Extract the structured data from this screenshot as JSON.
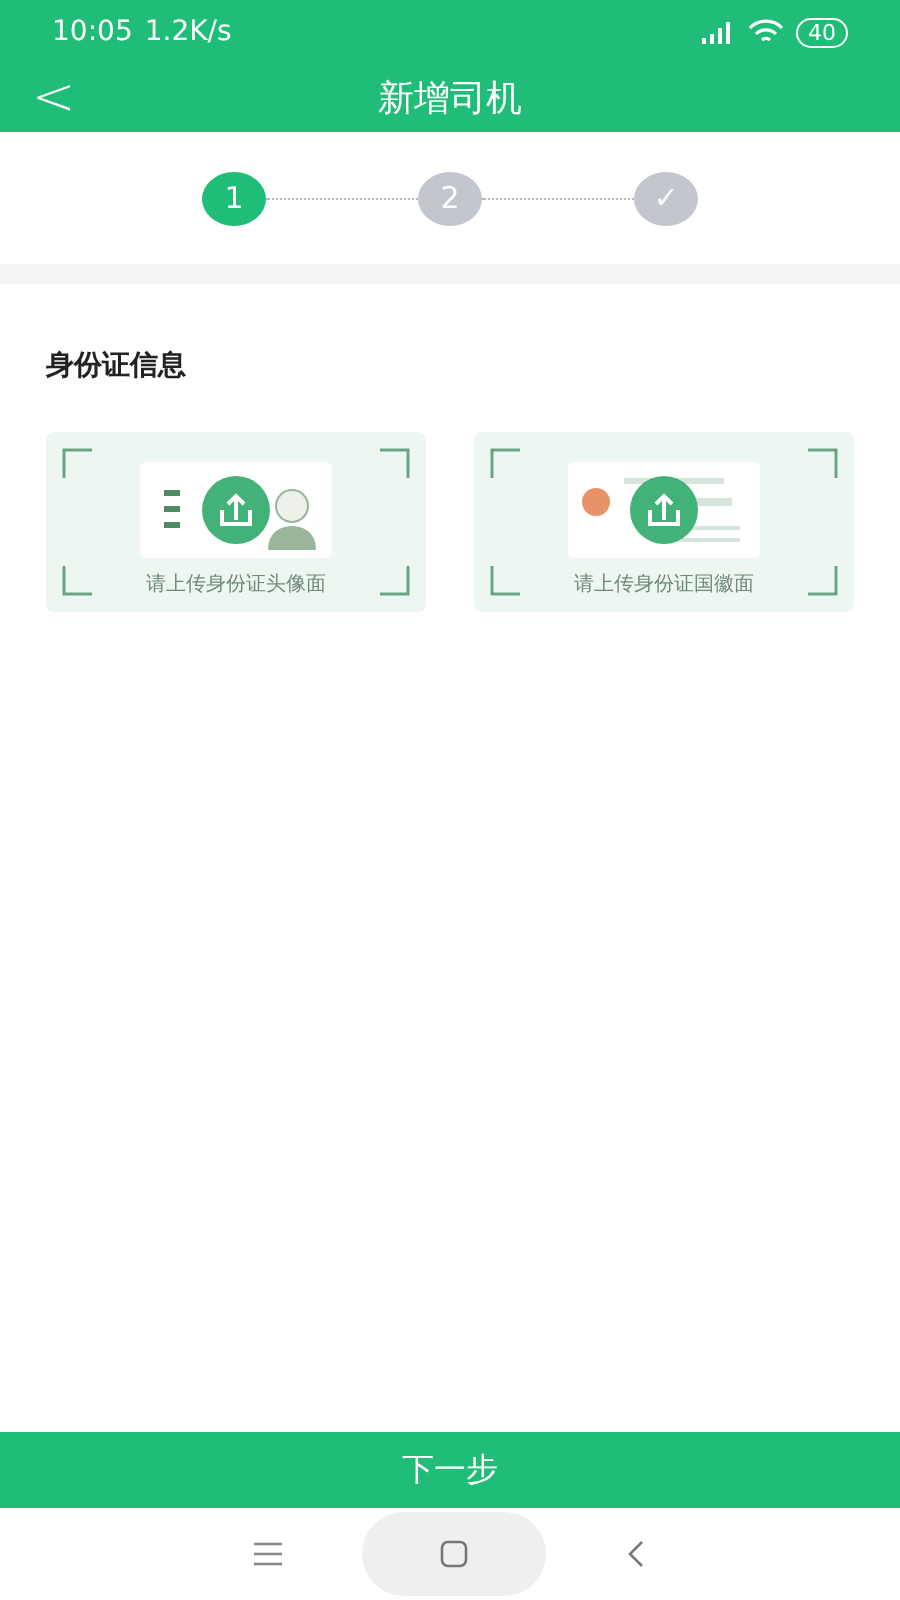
{
  "status_bar": {
    "time": "10:05",
    "speed": "1.2K/s",
    "battery": "40"
  },
  "header": {
    "back": "<",
    "title": "新增司机"
  },
  "steps": [
    {
      "label": "1",
      "selected": true
    },
    {
      "label": "2",
      "selected": false
    },
    {
      "label": "✓",
      "selected": false
    }
  ],
  "section_title": "身份证信息",
  "uploads": [
    {
      "kind": "portrait",
      "caption": "请上传身份证头像面"
    },
    {
      "kind": "emblem",
      "caption": "请上传身份证国徽面"
    }
  ],
  "next_button": "下一步"
}
